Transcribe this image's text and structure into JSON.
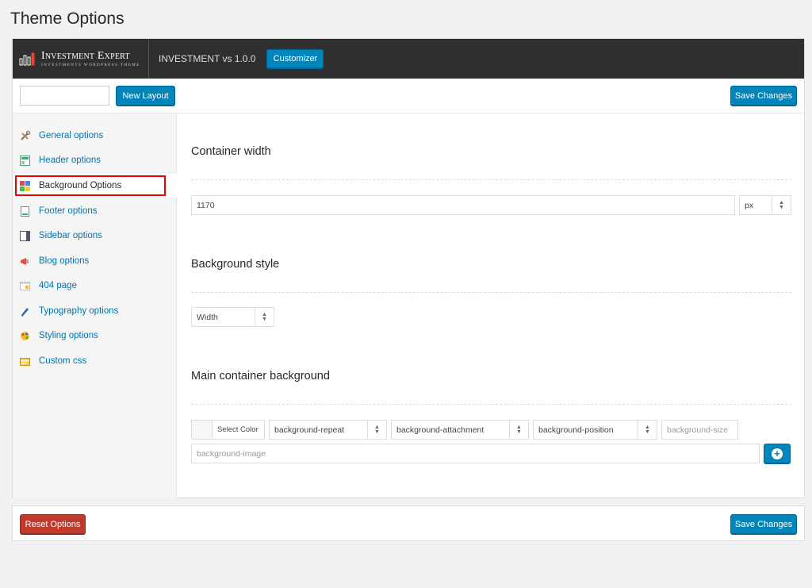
{
  "page_title": "Theme Options",
  "header": {
    "logo_title": "Investment Expert",
    "logo_subtitle": "INVESTMENTS WORDPRESS THEME",
    "version": "INVESTMENT vs 1.0.0",
    "customizer_label": "Customizer"
  },
  "toolbar": {
    "layout_input_value": "",
    "new_layout_label": "New Layout",
    "save_label": "Save Changes"
  },
  "sidebar": {
    "items": [
      {
        "label": "General options",
        "icon": "tools-icon"
      },
      {
        "label": "Header options",
        "icon": "header-icon"
      },
      {
        "label": "Background Options",
        "icon": "background-icon"
      },
      {
        "label": "Footer options",
        "icon": "footer-icon"
      },
      {
        "label": "Sidebar options",
        "icon": "sidebar-icon"
      },
      {
        "label": "Blog options",
        "icon": "megaphone-icon"
      },
      {
        "label": "404 page",
        "icon": "page-404-icon"
      },
      {
        "label": "Typography options",
        "icon": "pen-icon"
      },
      {
        "label": "Styling options",
        "icon": "palette-icon"
      },
      {
        "label": "Custom css",
        "icon": "css-icon"
      }
    ],
    "active_index": 2
  },
  "content": {
    "container_width": {
      "title": "Container width",
      "value": "1170",
      "unit": "px"
    },
    "background_style": {
      "title": "Background style",
      "value": "Width"
    },
    "main_container_background": {
      "title": "Main container background",
      "select_color_label": "Select Color",
      "repeat": "background-repeat",
      "attachment": "background-attachment",
      "position": "background-position",
      "size_placeholder": "background-size",
      "image_placeholder": "background-image"
    }
  },
  "footer": {
    "reset_label": "Reset Options",
    "save_label": "Save Changes"
  },
  "colors": {
    "primary_blue": "#0085ba",
    "danger_red": "#c0392b",
    "topbar_dark": "#2f2f2f",
    "link_blue": "#0073aa",
    "highlight_red": "#e00000"
  }
}
